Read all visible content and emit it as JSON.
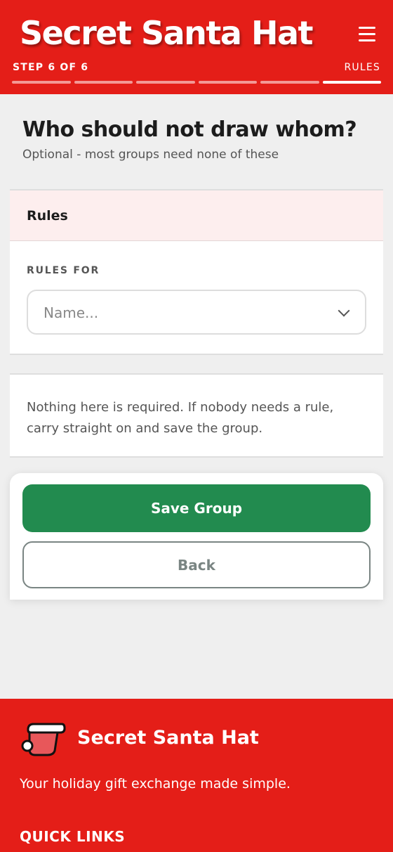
{
  "header": {
    "app_title": "Secret Santa Hat",
    "step_label": "STEP 6 OF 6",
    "step_name": "RULES",
    "progress": {
      "current_step": 6,
      "total_steps": 6
    },
    "menu_icon": "hamburger-menu-icon"
  },
  "main": {
    "heading": "Who should not draw whom?",
    "subheading": "Optional - most groups need none of these",
    "rules_card": {
      "title": "Rules",
      "field_label": "RULES FOR",
      "select_placeholder": "Name...",
      "select_icon": "chevron-down-icon"
    },
    "info_text": "Nothing here is required. If nobody needs a rule, carry straight on and save the group.",
    "actions": {
      "save_label": "Save Group",
      "back_label": "Back"
    }
  },
  "footer": {
    "logo_icon": "santa-hat-icon",
    "title": "Secret Santa Hat",
    "tagline": "Your holiday gift exchange made simple.",
    "quick_links_title": "QUICK LINKS"
  },
  "colors": {
    "brand_red": "#e41e18",
    "primary_green": "#228b4f",
    "rules_header_bg": "#fdeeee",
    "back_border": "#7a8583",
    "page_bg": "#efefef"
  }
}
